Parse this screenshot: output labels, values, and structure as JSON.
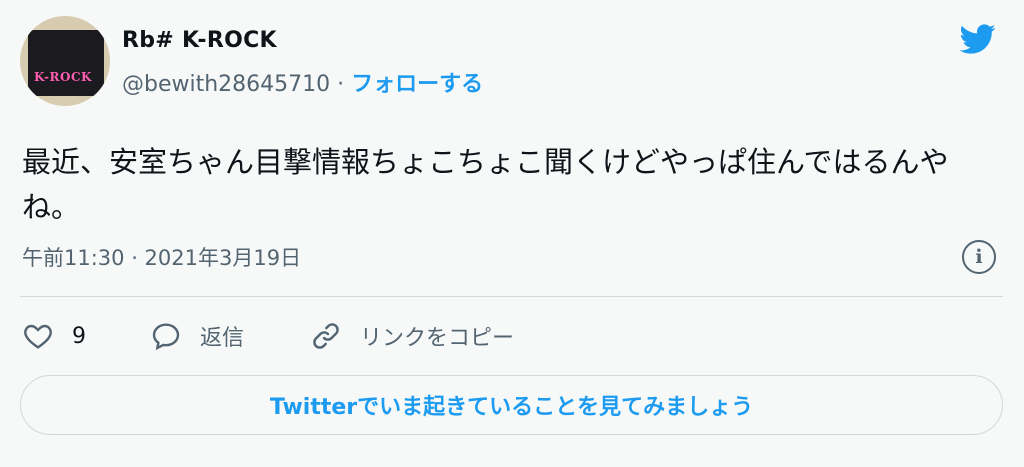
{
  "author": {
    "name": "Rb# K-ROCK",
    "handle": "@bewith28645710",
    "separator": " · ",
    "follow_label": "フォローする",
    "avatar_logo_text": "K-ROCK"
  },
  "brand": {
    "icon": "twitter-bird-icon",
    "color": "#1d9bf0"
  },
  "tweet": {
    "text": "最近、安室ちゃん目撃情報ちょこちょこ聞くけどやっぱ住んではるんやね。",
    "timestamp": "午前11:30 · 2021年3月19日"
  },
  "actions": {
    "like_count": "9",
    "reply_label": "返信",
    "copy_link_label": "リンクをコピー"
  },
  "cta": {
    "label": "Twitterでいま起きていることを見てみましょう"
  },
  "icons": {
    "info": "info-icon",
    "like": "heart-icon",
    "reply": "speech-bubble-icon",
    "link": "link-icon"
  }
}
